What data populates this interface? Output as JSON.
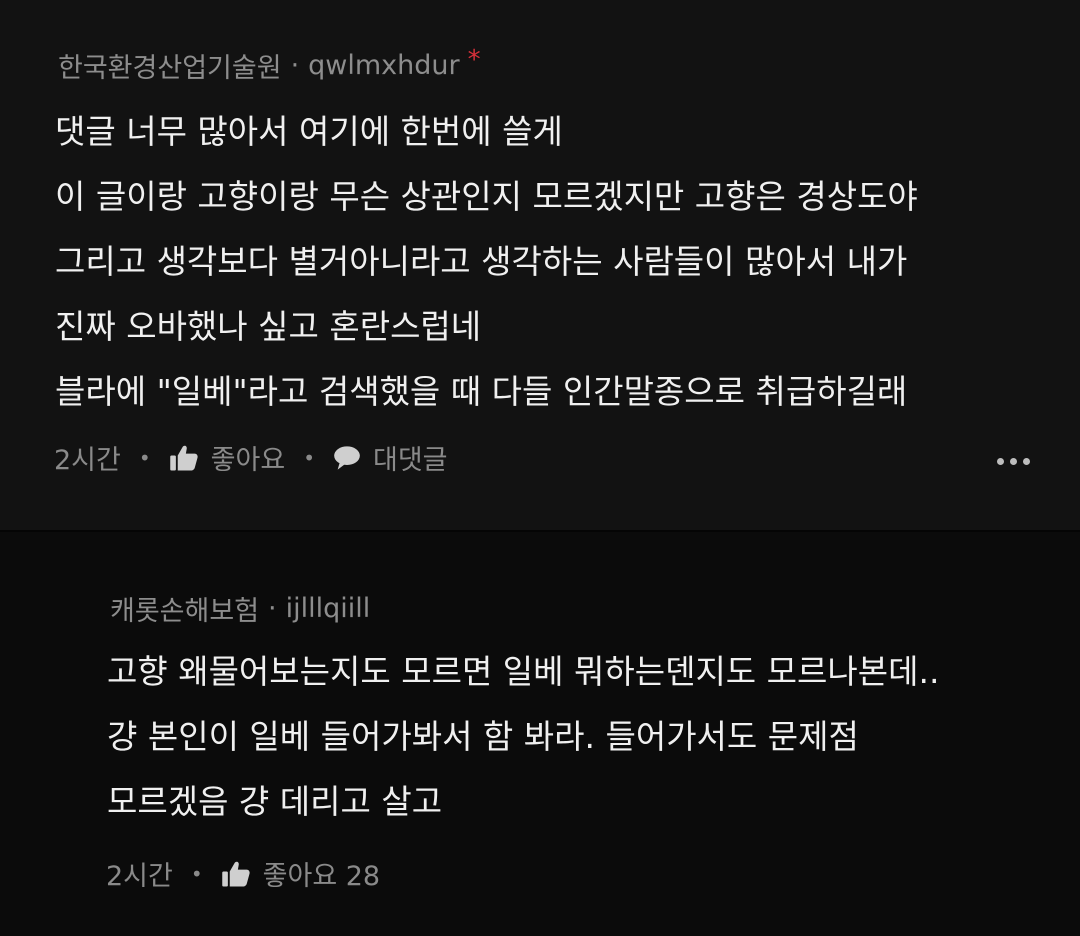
{
  "comment": {
    "author_org": "한국환경산업기술원",
    "separator": "·",
    "username": "qwlmxhdur",
    "author_mark": "*",
    "lines": [
      "댓글 너무 많아서 여기에 한번에 쓸게",
      "이 글이랑 고향이랑 무슨 상관인지 모르겠지만 고향은 경상도야",
      "그리고 생각보다 별거아니라고 생각하는 사람들이 많아서 내가",
      "진짜 오바했나 싶고 혼란스럽네",
      "블라에 \"일베\"라고 검색했을 때 다들 인간말종으로 취급하길래"
    ],
    "time": "2시간",
    "like_label": "좋아요",
    "reply_label": "대댓글"
  },
  "reply": {
    "author_org": "캐롯손해보험",
    "separator": "·",
    "username": "ijlllqiill",
    "lines": [
      "고향 왜물어보는지도 모르면 일베 뭐하는덴지도 모르나본데..",
      "걍 본인이 일베 들어가봐서 함 봐라. 들어가서도 문제점",
      "모르겠음 걍 데리고 살고"
    ],
    "time": "2시간",
    "like_label": "좋아요 28"
  },
  "icons": {
    "like": "thumbs-up-icon",
    "reply": "speech-bubble-icon",
    "more": "more-horizontal-icon"
  },
  "colors": {
    "background": "#121212",
    "reply_background": "#0b0b0b",
    "text": "#f0f0f0",
    "muted": "#8d8d8d",
    "badge": "#d8303a"
  }
}
